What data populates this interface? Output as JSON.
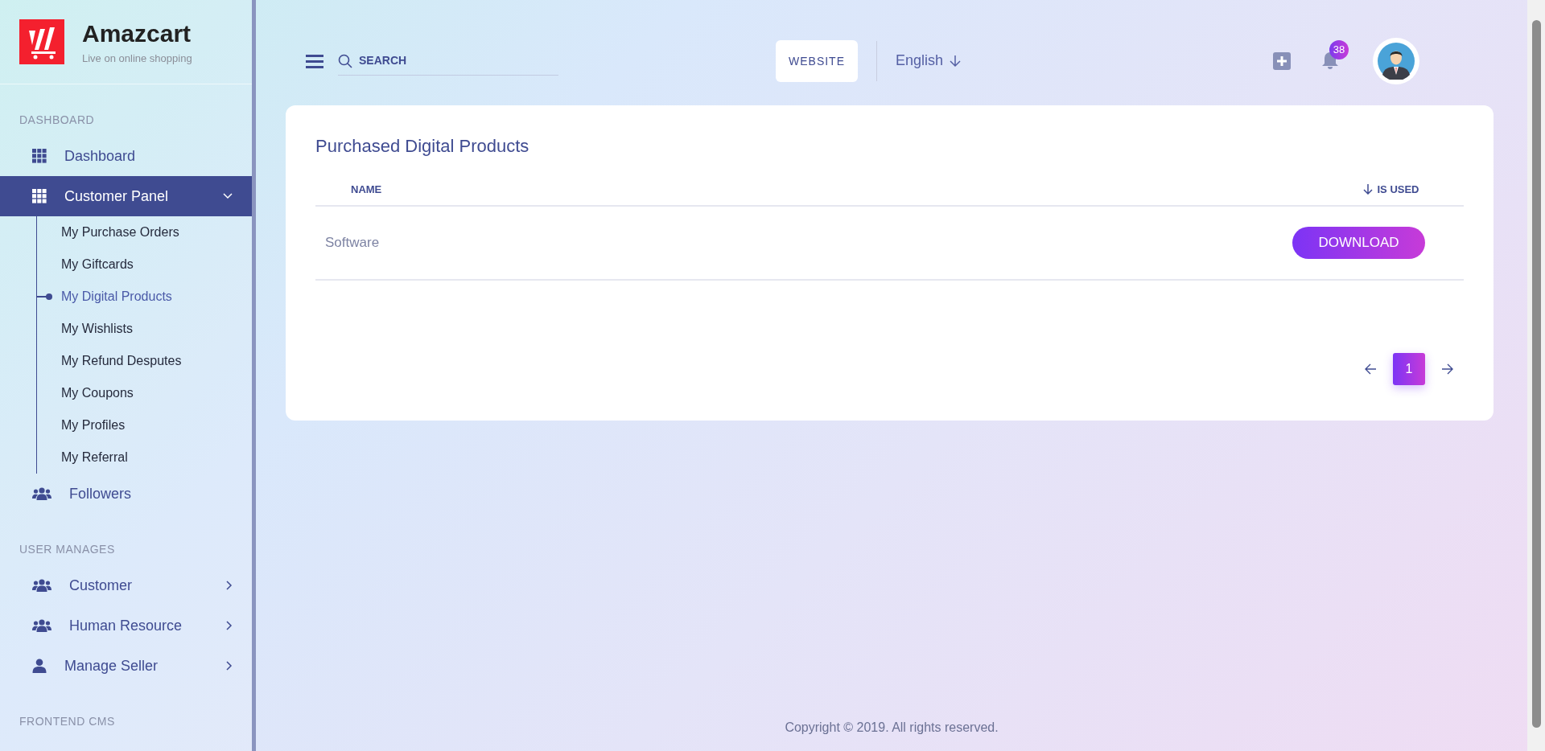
{
  "sidebar": {
    "logo": {
      "name": "Amazcart",
      "tagline": "Live on online shopping"
    },
    "sections": [
      {
        "heading": "DASHBOARD",
        "items": [
          {
            "label": "Dashboard",
            "kind": "grid",
            "selected": false
          },
          {
            "label": "Customer Panel",
            "kind": "grid",
            "selected": true,
            "expanded": true,
            "children": [
              {
                "label": "My Purchase Orders",
                "selected": false
              },
              {
                "label": "My Giftcards",
                "selected": false
              },
              {
                "label": "My Digital Products",
                "selected": true
              },
              {
                "label": "My Wishlists",
                "selected": false
              },
              {
                "label": "My Refund Desputes",
                "selected": false
              },
              {
                "label": "My Coupons",
                "selected": false
              },
              {
                "label": "My Profiles",
                "selected": false
              },
              {
                "label": "My Referral",
                "selected": false
              }
            ]
          },
          {
            "label": "Followers",
            "kind": "users",
            "selected": false
          }
        ]
      },
      {
        "heading": "USER MANAGES",
        "items": [
          {
            "label": "Customer",
            "kind": "users",
            "selected": false,
            "expanded": false
          },
          {
            "label": "Human Resource",
            "kind": "users",
            "selected": false,
            "expanded": false
          },
          {
            "label": "Manage Seller",
            "kind": "user",
            "selected": false,
            "expanded": false
          }
        ]
      },
      {
        "heading": "FRONTEND CMS"
      }
    ]
  },
  "header": {
    "search": {
      "placeholder": "SEARCH"
    },
    "website_button": "WEBSITE",
    "language": "English",
    "notifications": "38"
  },
  "card": {
    "title": "Purchased Digital Products",
    "table": {
      "columns": [
        {
          "label": "NAME",
          "sorted": false
        },
        {
          "label": "IS USED",
          "sorted": true
        }
      ],
      "rows": [
        {
          "name": "Software",
          "action": "DOWNLOAD"
        }
      ]
    },
    "pagination": {
      "pages": [
        {
          "label": "1",
          "selected": true
        }
      ]
    }
  },
  "footer": "Copyright © 2019. All rights reserved."
}
